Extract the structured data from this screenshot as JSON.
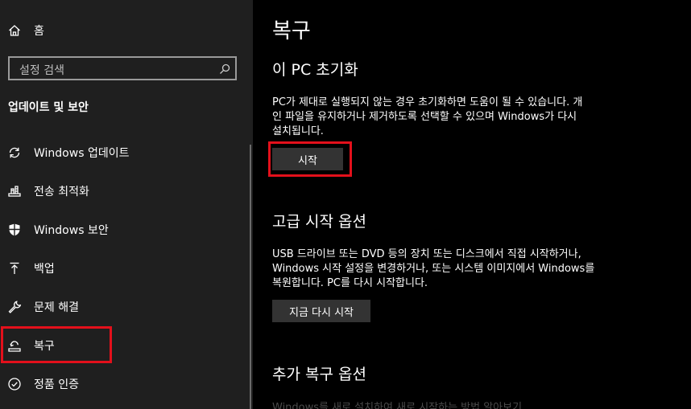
{
  "sidebar": {
    "home_label": "홈",
    "search_placeholder": "설정 검색",
    "section_title": "업데이트 및 보안",
    "items": [
      {
        "label": "Windows 업데이트",
        "icon": "sync-icon"
      },
      {
        "label": "전송 최적화",
        "icon": "delivery-optimization-icon"
      },
      {
        "label": "Windows 보안",
        "icon": "shield-icon"
      },
      {
        "label": "백업",
        "icon": "backup-arrow-icon"
      },
      {
        "label": "문제 해결",
        "icon": "wrench-icon"
      },
      {
        "label": "복구",
        "icon": "recovery-icon"
      },
      {
        "label": "정품 인증",
        "icon": "check-circle-icon"
      }
    ],
    "highlight_color": "#e3101b"
  },
  "main": {
    "title": "복구",
    "reset": {
      "heading": "이 PC 초기화",
      "desc_lines": [
        "PC가 제대로 실행되지 않는 경우 초기화하면 도움이 될 수 있습니다. 개",
        "인 파일을 유지하거나 제거하도록 선택할 수 있으며 Windows가 다시",
        "설치됩니다."
      ],
      "button_label": "시작"
    },
    "advanced": {
      "heading": "고급 시작 옵션",
      "desc_lines": [
        "USB 드라이브 또는 DVD 등의 장치 또는 디스크에서 직접 시작하거나,",
        "Windows 시작 설정을 변경하거나, 또는 시스템 이미지에서 Windows를",
        "복원합니다. PC를 다시 시작합니다."
      ],
      "button_label": "지금 다시 시작"
    },
    "more": {
      "heading": "추가 복구 옵션",
      "link_text": "Windows를 새로 설치하여 새로 시작하는 방법 알아보기"
    }
  }
}
